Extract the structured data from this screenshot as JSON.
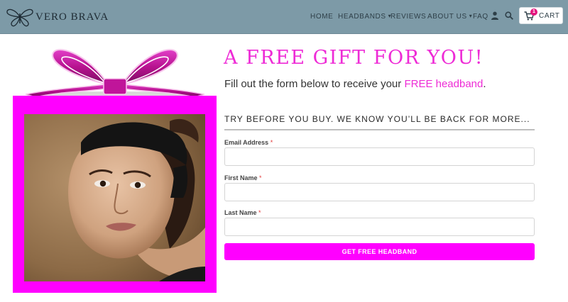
{
  "brand": {
    "name": "VERO BRAVA",
    "logo_icon": "butterfly-logo-icon"
  },
  "nav": {
    "home": "HOME",
    "headbands": "HEADBANDS",
    "reviews": "REVIEWS",
    "about": "ABOUT US",
    "faq": "FAQ",
    "dropdown_caret": "▾",
    "user_icon": "user-icon",
    "search_icon": "search-icon",
    "cart": {
      "label": "CART",
      "count": "1",
      "icon": "cart-icon"
    }
  },
  "hero": {
    "headline": "A FREE GIFT FOR YOU!",
    "subline_prefix": "Fill out the form below to receive your ",
    "subline_highlight": "FREE headband",
    "subline_suffix": ".",
    "tagline": "TRY BEFORE YOU BUY. WE KNOW YOU’LL BE BACK FOR MORE..."
  },
  "form": {
    "required_marker": "*",
    "fields": [
      {
        "label": "Email Address",
        "value": "",
        "placeholder": ""
      },
      {
        "label": "First Name",
        "value": "",
        "placeholder": ""
      },
      {
        "label": "Last Name",
        "value": "",
        "placeholder": ""
      }
    ],
    "submit_label": "GET FREE HEADBAND"
  },
  "colors": {
    "header_bg": "#7d9aa7",
    "accent_magenta": "#ff00ff",
    "headline_pink": "#ee2bd6",
    "badge_pink": "#e4157e"
  }
}
